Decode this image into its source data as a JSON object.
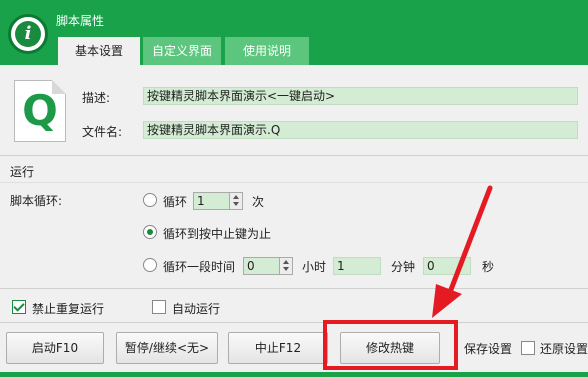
{
  "window": {
    "title": "脚本属性"
  },
  "tabs": [
    {
      "label": "基本设置",
      "active": true
    },
    {
      "label": "自定义界面",
      "active": false
    },
    {
      "label": "使用说明",
      "active": false
    }
  ],
  "script_info": {
    "desc_label": "描述:",
    "desc_value": "按键精灵脚本界面演示<一键启动>",
    "file_label": "文件名:",
    "file_value": "按键精灵脚本界面演示.Q",
    "file_icon_letter": "Q"
  },
  "run": {
    "section_title": "运行",
    "loop_label": "脚本循环:",
    "opt_loop": {
      "label": "循环",
      "count": "1",
      "unit": "次",
      "checked": false
    },
    "opt_until_stop": {
      "label": "循环到按中止键为止",
      "checked": true
    },
    "opt_duration": {
      "label": "循环一段时间",
      "hours": "0",
      "hours_unit": "小时",
      "minutes": "1",
      "minutes_unit": "分钟",
      "seconds": "0",
      "seconds_unit": "秒",
      "checked": false
    }
  },
  "options": {
    "no_repeat": {
      "label": "禁止重复运行",
      "checked": true
    },
    "auto_run": {
      "label": "自动运行",
      "checked": false
    }
  },
  "buttons": {
    "start": "启动F10",
    "pause": "暂停/继续<无>",
    "stop": "中止F12",
    "hotkey": "修改热键",
    "save": "保存设置",
    "restore": "还原设置"
  },
  "colors": {
    "header_green": "#1aa24b",
    "field_green": "#d3ecd3",
    "highlight_red": "#e51b24"
  }
}
